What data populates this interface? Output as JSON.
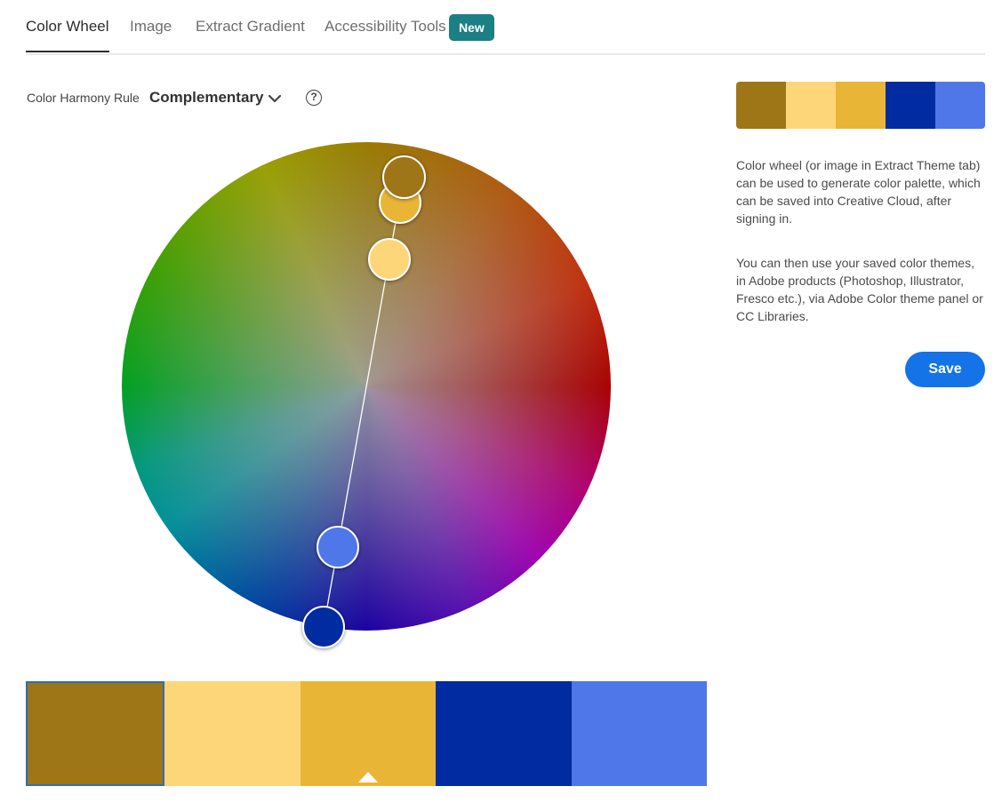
{
  "tabs": [
    {
      "label": "Color Wheel",
      "active": true
    },
    {
      "label": "Image",
      "active": false
    },
    {
      "label": "Extract Gradient",
      "active": false
    },
    {
      "label": "Accessibility Tools",
      "active": false
    }
  ],
  "new_badge": "New",
  "harmony": {
    "label": "Color Harmony Rule",
    "value": "Complementary",
    "help_symbol": "?"
  },
  "palette": {
    "colors": [
      "#9E7617",
      "#FDD67A",
      "#E8B537",
      "#002BA1",
      "#4F77EA"
    ],
    "selected_index": 0,
    "base_index": 2
  },
  "info": {
    "paragraph1": "Color wheel (or image in Extract Theme tab) can be used to generate color palette, which can be saved into Creative Cloud, after signing in.",
    "paragraph2": "You can then use your saved color themes, in Adobe products (Photoshop, Illustrator, Fresco etc.), via Adobe Color theme panel or CC Libraries."
  },
  "save_label": "Save",
  "icons": {
    "dropdown": "chevron-down-icon",
    "help": "help-circle-icon",
    "base_marker": "triangle-up-icon"
  }
}
